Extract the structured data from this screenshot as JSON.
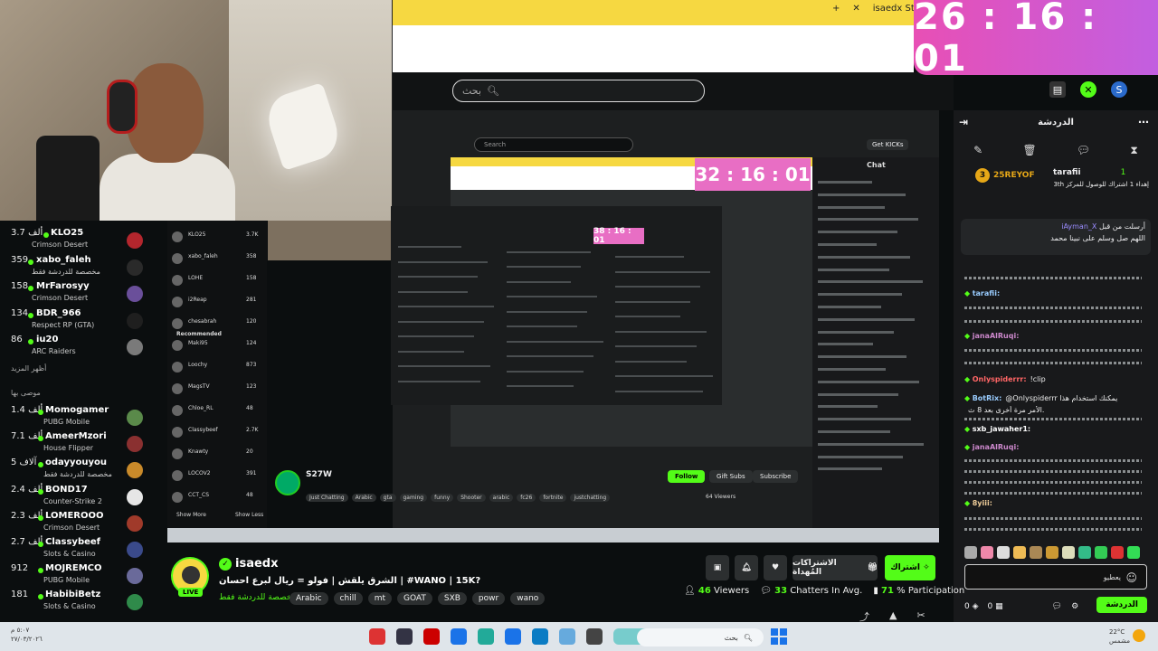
{
  "timer": "26 : 16 : 01",
  "browser": {
    "tab_label": "isaedx Stream",
    "search_placeholder": "بحث"
  },
  "capture": {
    "search": "Search",
    "get_kicks": "Get KICKs",
    "chat_title": "Chat",
    "timer": "32 : 16 : 01",
    "timer2": "38 : 16 : 01",
    "streamer_name": "S27W",
    "tags": [
      "Just Chatting",
      "Arabic",
      "gta",
      "gaming",
      "funny",
      "Shooter",
      "arabic",
      "fc26",
      "fortnite",
      "justchatting"
    ],
    "follow": "Follow",
    "gift": "Gift Subs",
    "subscribe": "Subscribe",
    "viewers": "64 Viewers",
    "left_items": [
      {
        "name": "KLO25",
        "count": "3.7K"
      },
      {
        "name": "xabo_faleh",
        "count": "358"
      },
      {
        "name": "LOHE",
        "count": "158"
      },
      {
        "name": "i2Reap",
        "count": "281"
      },
      {
        "name": "chesabrah",
        "count": "120"
      },
      {
        "name": "Maki95",
        "count": "124"
      },
      {
        "name": "Loochy",
        "count": "873"
      },
      {
        "name": "MagsTV",
        "count": "123"
      },
      {
        "name": "Chloe_RL",
        "count": "48"
      },
      {
        "name": "Classybeef",
        "count": "2.7K"
      },
      {
        "name": "Knawty",
        "count": "20"
      },
      {
        "name": "LOCOV2",
        "count": "391"
      },
      {
        "name": "CCT_CS",
        "count": "48"
      }
    ],
    "recommended": "Recommended",
    "show_more": "Show More",
    "show_less": "Show Less"
  },
  "sidebar": {
    "items": [
      {
        "count": "3.7 ألف",
        "name": "KLO25",
        "category": "Crimson Desert",
        "avatar_color": "#b3262d"
      },
      {
        "count": "359",
        "name": "xabo_faleh",
        "category": "مخصصة للدردشة فقط",
        "avatar_color": "#2a2a2a"
      },
      {
        "count": "158",
        "name": "MrFarosyy",
        "category": "Crimson Desert",
        "avatar_color": "#6a4f9a"
      },
      {
        "count": "134",
        "name": "BDR_966",
        "category": "Respect RP (GTA)",
        "avatar_color": "#1f1f1f"
      },
      {
        "count": "86",
        "name": "iu20",
        "category": "ARC Raiders",
        "avatar_color": "#7a7a7a"
      }
    ],
    "show_more": "أظهر المزيد",
    "recommended": "موصى بها",
    "rec_items": [
      {
        "count": "1.4 ألف",
        "name": "Momogamer",
        "category": "PUBG Mobile",
        "avatar_color": "#5a8a4a"
      },
      {
        "count": "7.1 ألف",
        "name": "AmeerMzori",
        "category": "House Flipper",
        "avatar_color": "#8a3030"
      },
      {
        "count": "5 آلاف",
        "name": "odayyouyou",
        "category": "مخصصة للدردشة فقط",
        "avatar_color": "#c98a2a"
      },
      {
        "count": "2.4 ألف",
        "name": "BOND17",
        "category": "Counter-Strike 2",
        "avatar_color": "#e6e6e6"
      },
      {
        "count": "2.3 ألف",
        "name": "LOMEROOO",
        "category": "Crimson Desert",
        "avatar_color": "#a03a2a"
      },
      {
        "count": "2.7 ألف",
        "name": "Classybeef",
        "category": "Slots & Casino",
        "avatar_color": "#3a4a8a"
      },
      {
        "count": "912",
        "name": "MOJREMCO",
        "category": "PUBG Mobile",
        "avatar_color": "#6a6a9a"
      },
      {
        "count": "181",
        "name": "HabibiBetz",
        "category": "Slots & Casino",
        "avatar_color": "#2f8a4a"
      }
    ]
  },
  "chat": {
    "title": "الدردشة",
    "gifters": [
      {
        "rank": "1",
        "name": "tarafii",
        "note": "إهداء 1 اشتراك للوصول للمركز 3th"
      },
      {
        "rank": "3",
        "name": "25REYOF",
        "note": ""
      }
    ],
    "pinned": {
      "by": "أرسلت من قبل",
      "name": "iAyman_X",
      "text": "اللهم صل وسلم على نبينا محمد"
    },
    "messages": [
      {
        "user": "tarafii:",
        "text": "",
        "color": "#9cf"
      },
      {
        "user": "janaAlRuqi:",
        "text": "",
        "color": "#c8c"
      },
      {
        "user": "Onlyspiderrr:",
        "text": "!clip",
        "color": "#f66"
      },
      {
        "user": "BotRix:",
        "text": "@Onlyspiderrr يمكنك استخدام هذا",
        "color": "#9cf"
      },
      {
        "user": "",
        "text": "الأمر مرة أخرى بعد 8 ث.",
        "color": "#fff"
      },
      {
        "user": "sxb_jawaher1:",
        "text": "",
        "color": "#fff"
      },
      {
        "user": "janaAlRuqi:",
        "text": "",
        "color": "#c8c"
      },
      {
        "user": "8yiii:",
        "text": "",
        "color": "#ec9"
      }
    ],
    "input_placeholder": "يعطيو",
    "count_left": "0",
    "count_right": "0",
    "send": "الدردشة"
  },
  "stream": {
    "name": "isaedx",
    "live": "LIVE",
    "title": "الشرق يلقش | فولو = ريال لبرع احسان | #WANO | 15K?",
    "category": "مخصصة للدردشة فقط",
    "tags": [
      "Arabic",
      "chill",
      "mt",
      "GOAT",
      "SXB",
      "powr",
      "wano"
    ],
    "follow": "اشتراك",
    "subs": "الاشتراكات المُهداة",
    "viewers": "46",
    "viewers_label": "Viewers",
    "chatters": "33",
    "chatters_label": "Chatters In Avg.",
    "participation": "71",
    "participation_label": "% Participation"
  },
  "taskbar": {
    "search": "بحث",
    "date": "٥:٠٧ م",
    "date2": "٢٧/٠٣/٢٠٢٦",
    "weather": "22°C",
    "weather_label": "مشمس"
  }
}
